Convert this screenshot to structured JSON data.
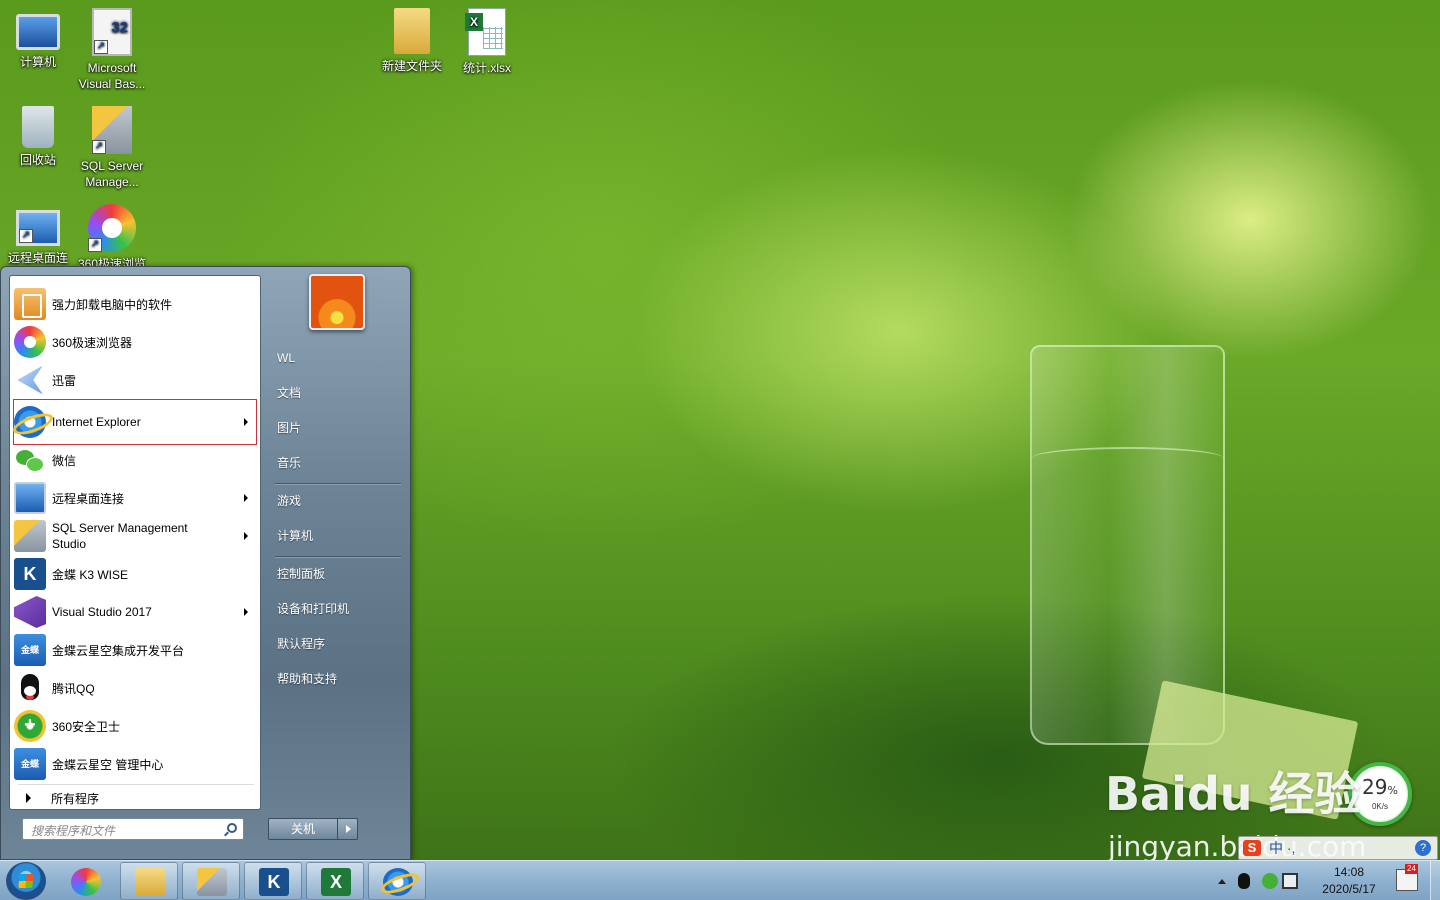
{
  "desktop": {
    "icons": [
      {
        "label": "计算机",
        "icon": "computer-icon"
      },
      {
        "label": "Microsoft Visual Bas...",
        "icon": "vb-icon"
      },
      {
        "label": "回收站",
        "icon": "recycle-bin-icon"
      },
      {
        "label": "SQL Server Manage...",
        "icon": "sql-server-icon"
      },
      {
        "label": "远程桌面连",
        "icon": "remote-desktop-icon"
      },
      {
        "label": "360极速浏览",
        "icon": "360-browser-icon"
      },
      {
        "label": "新建文件夹",
        "icon": "folder-icon"
      },
      {
        "label": "统计.xlsx",
        "icon": "excel-file-icon"
      }
    ]
  },
  "start_menu": {
    "programs": [
      {
        "label": "强力卸载电脑中的软件",
        "icon": "uninstall-icon",
        "arrow": false
      },
      {
        "label": "360极速浏览器",
        "icon": "360-browser-icon",
        "arrow": false
      },
      {
        "label": "迅雷",
        "icon": "xunlei-icon",
        "arrow": false
      },
      {
        "label": "Internet Explorer",
        "icon": "ie-icon",
        "arrow": true,
        "highlighted": true
      },
      {
        "label": "微信",
        "icon": "wechat-icon",
        "arrow": false
      },
      {
        "label": "远程桌面连接",
        "icon": "remote-desktop-icon",
        "arrow": true
      },
      {
        "label": "SQL Server Management Studio",
        "icon": "sql-server-icon",
        "arrow": true
      },
      {
        "label": "金蝶 K3 WISE",
        "icon": "k3-icon",
        "arrow": false
      },
      {
        "label": "Visual Studio 2017",
        "icon": "visual-studio-icon",
        "arrow": true
      },
      {
        "label": "金蝶云星空集成开发平台",
        "icon": "kingdee-cloud-icon",
        "arrow": false
      },
      {
        "label": "腾讯QQ",
        "icon": "qq-icon",
        "arrow": false
      },
      {
        "label": "360安全卫士",
        "icon": "360-safe-icon",
        "arrow": false
      },
      {
        "label": "金蝶云星空 管理中心",
        "icon": "kingdee-cloud-icon",
        "arrow": false
      }
    ],
    "all_programs": "所有程序",
    "search_placeholder": "搜索程序和文件",
    "right_items": [
      "WL",
      "文档",
      "图片",
      "音乐",
      "游戏",
      "计算机",
      "控制面板",
      "设备和打印机",
      "默认程序",
      "帮助和支持"
    ],
    "shutdown_label": "关机"
  },
  "taskbar": {
    "pinned": [
      "360-browser-icon",
      "explorer-icon",
      "sql-server-icon",
      "k3-icon",
      "excel-icon",
      "ie-icon"
    ],
    "clock_time": "14:08",
    "clock_date": "2020/5/17",
    "notify_badge": "24"
  },
  "gadget": {
    "percent": "29",
    "percent_unit": "%",
    "rate": "0K/s"
  },
  "ime": {
    "logo": "S",
    "text": "中 ·,",
    "help": "?"
  },
  "watermark": {
    "main": "Baidu 经验",
    "sub": "jingyan.baidu.com"
  }
}
